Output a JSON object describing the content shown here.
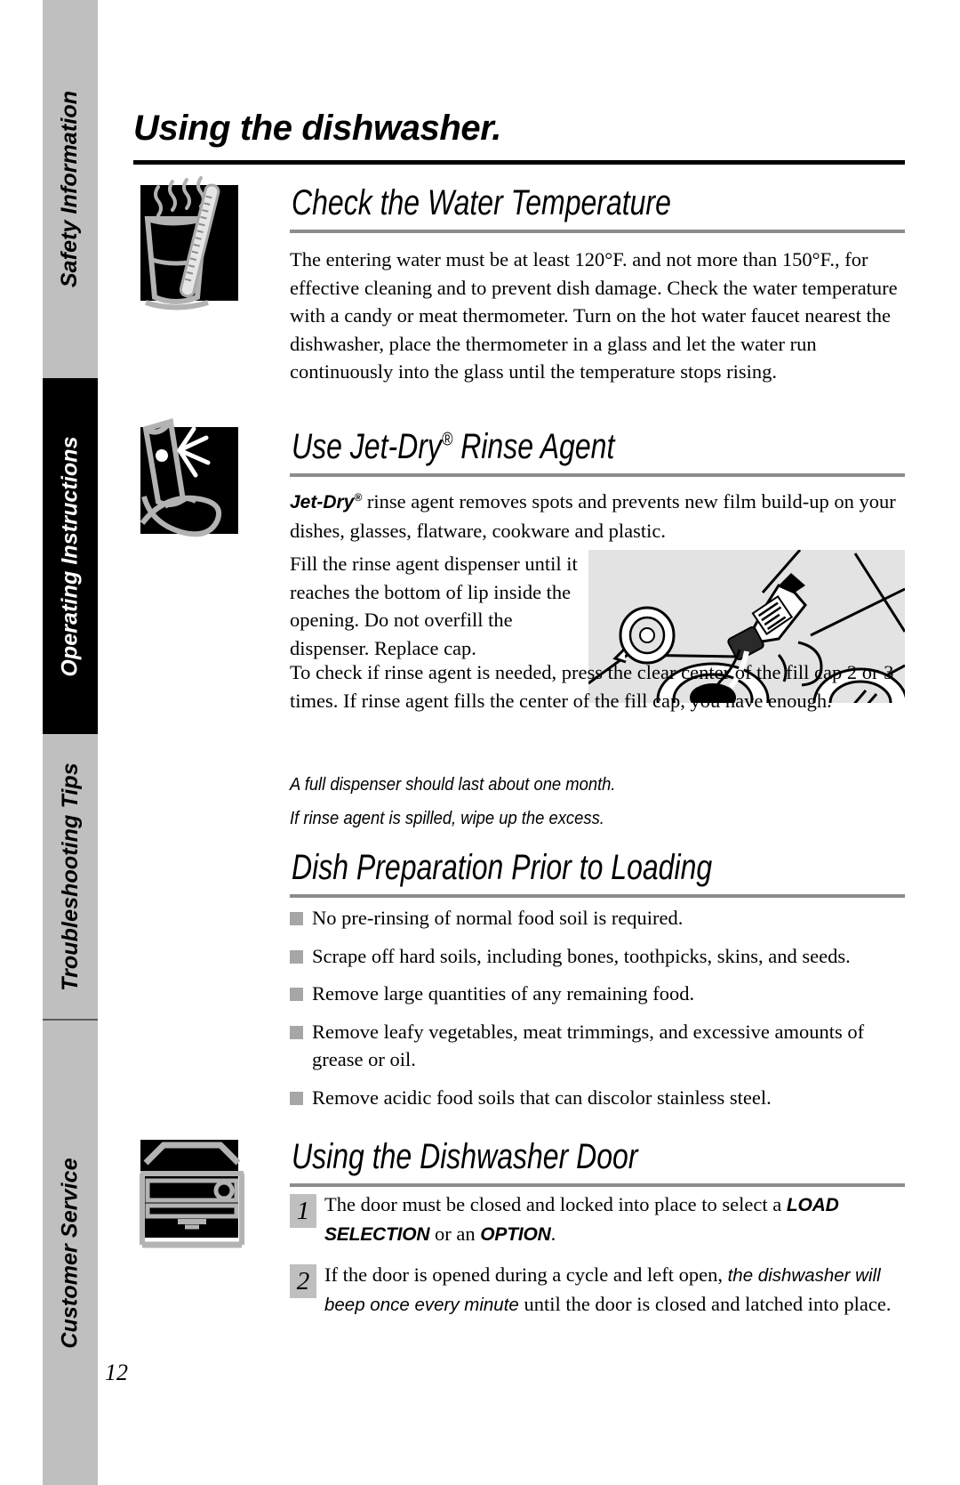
{
  "document": {
    "page_title": "Using the dishwasher.",
    "page_number": "12"
  },
  "sidebar": {
    "tabs": [
      {
        "label": "Safety Information",
        "style": "gray"
      },
      {
        "label": "Operating Instructions",
        "style": "black"
      },
      {
        "label": "Troubleshooting Tips",
        "style": "gray"
      },
      {
        "label": "Customer Service",
        "style": "gray"
      }
    ]
  },
  "sections": {
    "water_temp": {
      "heading": "Check the Water Temperature",
      "icon": "glass-thermometer-icon",
      "paragraph": "The entering water must be at least 120°F. and not more than 150°F., for effective cleaning and to prevent dish damage. Check the water temperature with a candy or meat thermometer. Turn on the hot water faucet nearest the dishwasher, place the thermometer in a glass and let the water run continuously into the glass until the temperature stops rising."
    },
    "jet_dry": {
      "heading_pre": "Use Jet-Dry",
      "heading_reg": "®",
      "heading_post": " Rinse Agent",
      "icon": "sparkling-glass-icon",
      "intro_bold": "Jet-Dry",
      "intro_reg": "®",
      "intro_rest": " rinse agent removes spots and prevents new film build-up on your dishes, glasses, flatware, cookware and plastic.",
      "para_fill": "Fill the rinse agent dispenser until it reaches the bottom of lip inside the opening. Do not overfill the dispenser. Replace cap.",
      "para_check": "To check if rinse agent is needed, press the clear center of the fill cap 2 or 3 times. If rinse agent fills the center of the fill cap, you have enough.",
      "note_1": "A full dispenser should last about one month.",
      "note_2": "If rinse agent is spilled, wipe up the excess.",
      "photo_caption": "rinse-agent-dispenser-photo"
    },
    "dish_prep": {
      "heading": "Dish Preparation Prior to Loading",
      "bullets": [
        "No pre-rinsing of normal food soil is required.",
        "Scrape off hard soils, including bones, toothpicks, skins, and seeds.",
        "Remove large quantities of any remaining food.",
        "Remove leafy vegetables, meat trimmings, and excessive amounts of grease or oil.",
        "Remove acidic food soils that can discolor stainless steel."
      ]
    },
    "door": {
      "heading": "Using the Dishwasher Door",
      "icon": "dishwasher-icon",
      "steps": [
        {
          "number": "1",
          "text_a": "The door must be closed and locked into place to select a ",
          "bold_a": "LOAD SELECTION",
          "text_b": " or an ",
          "bold_b": "OPTION",
          "text_c": "."
        },
        {
          "number": "2",
          "text_a": "If the door is opened during a cycle and left open, ",
          "ital_a": "the dishwasher will beep once every minute",
          "text_b": " until the door is closed and latched into place."
        }
      ]
    }
  },
  "colors": {
    "tab_gray": "#bfbfbf",
    "tab_black": "#000000",
    "rule_gray": "#8c8c8c",
    "bullet_gray": "#a6a6a6",
    "photo_bg": "#e3e3e3"
  }
}
